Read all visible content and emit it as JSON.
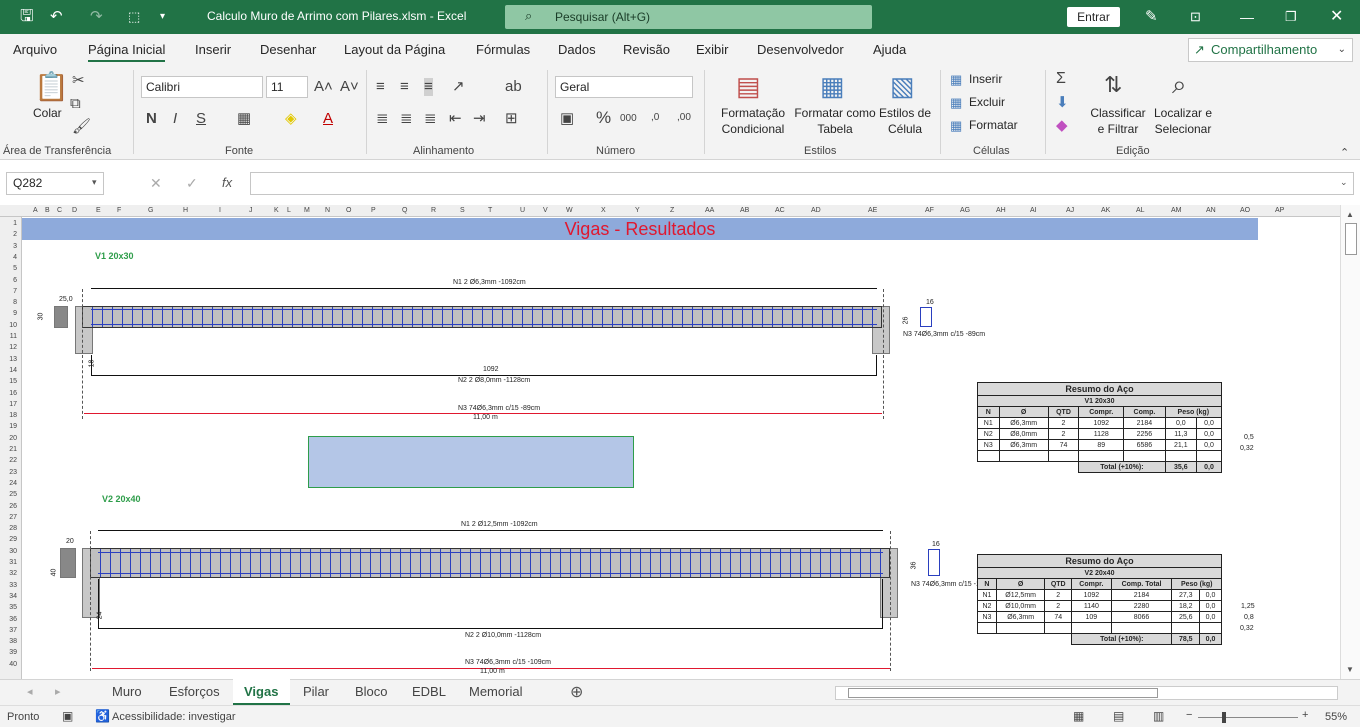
{
  "titlebar": {
    "title": "Calculo Muro de Arrimo com  Pilares.xlsm  -  Excel",
    "search_placeholder": "Pesquisar (Alt+G)",
    "signin": "Entrar"
  },
  "menu": [
    "Arquivo",
    "Página Inicial",
    "Inserir",
    "Desenhar",
    "Layout da Página",
    "Fórmulas",
    "Dados",
    "Revisão",
    "Exibir",
    "Desenvolvedor",
    "Ajuda"
  ],
  "share": "Compartilhamento",
  "ribbon": {
    "groups": [
      "Área de Transferência",
      "Fonte",
      "Alinhamento",
      "Número",
      "Estilos",
      "Células",
      "Edição"
    ],
    "paste": "Colar",
    "font_name": "Calibri",
    "font_size": "11",
    "number_format": "Geral",
    "cond_format": [
      "Formatação",
      "Condicional"
    ],
    "format_table": [
      "Formatar como",
      "Tabela"
    ],
    "cell_styles": [
      "Estilos de",
      "Célula"
    ],
    "insert": "Inserir",
    "delete": "Excluir",
    "format": "Formatar",
    "sort": [
      "Classificar",
      "e Filtrar"
    ],
    "find": [
      "Localizar e",
      "Selecionar"
    ],
    "bold": "N",
    "italic": "I",
    "underline": "S"
  },
  "formula_bar": {
    "cell": "Q282",
    "fx": "fx",
    "value": ""
  },
  "sheet": {
    "banner": "Vigas - Resultados",
    "v1": {
      "title": "V1 20x30",
      "n1": "N1 2 Ø6,3mm -1092cm",
      "n2": "N2 2 Ø8,0mm -1128cm",
      "len": "1092",
      "n3": "N3 74Ø6,3mm c/15 -89cm",
      "span": "11,00 m",
      "stirrup": "N3 74Ø6,3mm c/15 -89cm",
      "w": "25,0",
      "h": "30",
      "sw": "16",
      "sh": "26",
      "hook": "18",
      "table": {
        "title": "Resumo do Aço",
        "sub": "V1 20x30",
        "head": [
          "N",
          "Ø",
          "QTD",
          "Compr.",
          "Comp.",
          "Peso (kg)",
          ""
        ],
        "rows": [
          [
            "N1",
            "Ø6,3mm",
            "2",
            "1092",
            "2184",
            "0,0",
            "0,0"
          ],
          [
            "N2",
            "Ø8,0mm",
            "2",
            "1128",
            "2256",
            "11,3",
            "0,0"
          ],
          [
            "N3",
            "Ø6,3mm",
            "74",
            "89",
            "6586",
            "21,1",
            "0,0"
          ]
        ],
        "total_label": "Total (+10%):",
        "total": "35,6",
        "total2": "0,0",
        "extra": [
          "0,5",
          "0,32"
        ]
      }
    },
    "v2": {
      "title": "V2 20x40",
      "n1": "N1 2 Ø12,5mm -1092cm",
      "n2": "N2 2 Ø10,0mm -1128cm",
      "n3": "N3 74Ø6,3mm c/15 -109cm",
      "span": "11,00 m",
      "stirrup": "N3 74Ø6,3mm c/15 -109cm",
      "w": "20",
      "h": "40",
      "sw": "16",
      "sh": "36",
      "hook": "24",
      "table": {
        "title": "Resumo do Aço",
        "sub": "V2 20x40",
        "head": [
          "N",
          "Ø",
          "QTD",
          "Compr.",
          "Comp. Total",
          "Peso (kg)",
          ""
        ],
        "rows": [
          [
            "N1",
            "Ø12,5mm",
            "2",
            "1092",
            "2184",
            "27,3",
            "0,0"
          ],
          [
            "N2",
            "Ø10,0mm",
            "2",
            "1140",
            "2280",
            "18,2",
            "0,0"
          ],
          [
            "N3",
            "Ø6,3mm",
            "74",
            "109",
            "8066",
            "25,6",
            "0,0"
          ]
        ],
        "total_label": "Total (+10%):",
        "total": "78,5",
        "total2": "0,0",
        "extra": [
          "1,25",
          "0,8",
          "0,32"
        ]
      }
    }
  },
  "columns": [
    "A",
    "B",
    "C",
    "D",
    "E",
    "F",
    "G",
    "H",
    "I",
    "J",
    "K",
    "L",
    "M",
    "N",
    "O",
    "P",
    "Q",
    "R",
    "S",
    "T",
    "U",
    "V",
    "W",
    "X",
    "Y",
    "Z",
    "AA",
    "AB",
    "AC",
    "AD",
    "AE",
    "AF",
    "AG",
    "AH",
    "AI",
    "AJ",
    "AK",
    "AL",
    "AM",
    "AN",
    "AO",
    "AP"
  ],
  "rows": [
    "1",
    "2",
    "3",
    "4",
    "5",
    "6",
    "7",
    "8",
    "9",
    "10",
    "11",
    "12",
    "13",
    "14",
    "15",
    "16",
    "17",
    "18",
    "19",
    "20",
    "21",
    "22",
    "23",
    "24",
    "25",
    "26",
    "27",
    "28",
    "29",
    "30",
    "31",
    "32",
    "33",
    "34",
    "35",
    "36",
    "37",
    "38",
    "39",
    "40"
  ],
  "tabs": [
    "Muro",
    "Esforços",
    "Vigas",
    "Pilar",
    "Bloco",
    "EDBL",
    "Memorial"
  ],
  "active_tab": "Vigas",
  "status": {
    "ready": "Pronto",
    "accessibility": "Acessibilidade: investigar",
    "zoom": "55%"
  }
}
